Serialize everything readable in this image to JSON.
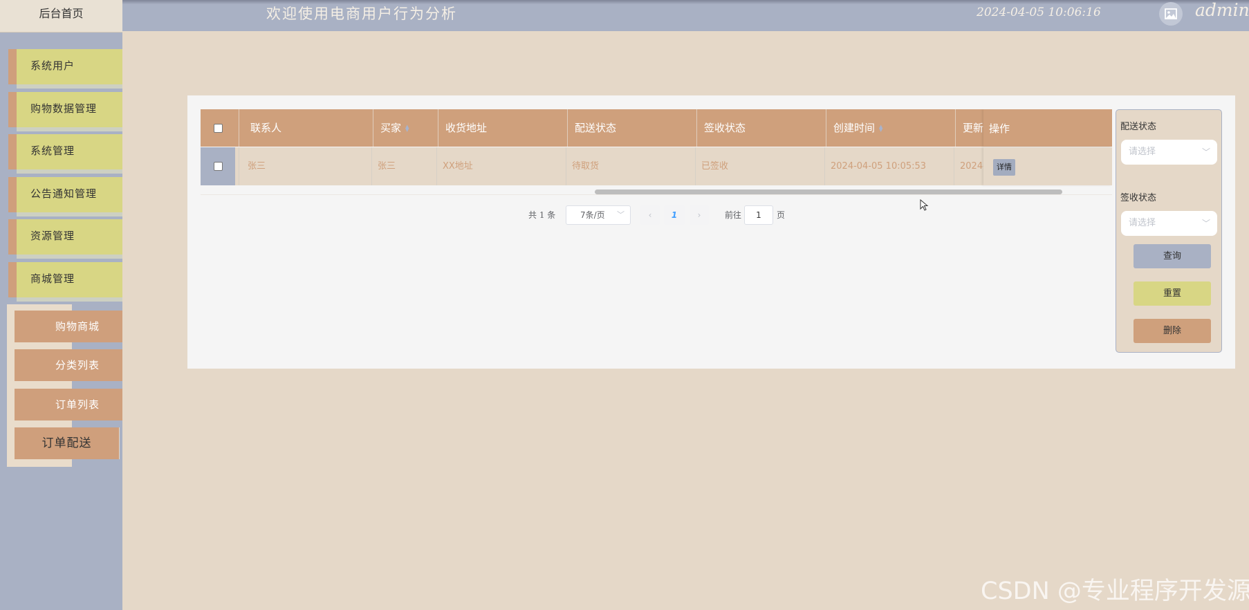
{
  "header": {
    "home_label": "后台首页",
    "welcome": "欢迎使用电商用户行为分析",
    "datetime": "2024-04-05 10:06:16",
    "username": "admin",
    "avatar_icon": "image-icon"
  },
  "sidebar": {
    "items": [
      {
        "label": "系统用户"
      },
      {
        "label": "购物数据管理"
      },
      {
        "label": "系统管理"
      },
      {
        "label": "公告通知管理"
      },
      {
        "label": "资源管理"
      },
      {
        "label": "商城管理"
      }
    ],
    "submenu": [
      {
        "label": "购物商城"
      },
      {
        "label": "分类列表"
      },
      {
        "label": "订单列表"
      },
      {
        "label": "订单配送",
        "active": true
      }
    ]
  },
  "table": {
    "columns": [
      "联系人",
      "买家",
      "收货地址",
      "配送状态",
      "签收状态",
      "创建时间",
      "更新",
      "操作"
    ],
    "rows": [
      {
        "contact": "张三",
        "buyer": "张三",
        "address": "XX地址",
        "delivery_status": "待取货",
        "sign_status": "已签收",
        "created": "2024-04-05 10:05:53",
        "updated": "2024-",
        "action": "详情"
      }
    ]
  },
  "pagination": {
    "total": "共 1 条",
    "page_size": "7条/页",
    "current_page": "1",
    "goto_label": "前往",
    "goto_value": "1",
    "page_unit": "页"
  },
  "filter": {
    "delivery_label": "配送状态",
    "delivery_placeholder": "请选择",
    "sign_label": "签收状态",
    "sign_placeholder": "请选择",
    "search_btn": "查询",
    "reset_btn": "重置",
    "delete_btn": "删除"
  },
  "watermark": "CSDN @专业程序开发源",
  "colors": {
    "sidebar_bg": "#a9b1c4",
    "menu_item": "#d8d684",
    "accent": "#cfa07c",
    "page_bg": "#e5d8c8"
  }
}
